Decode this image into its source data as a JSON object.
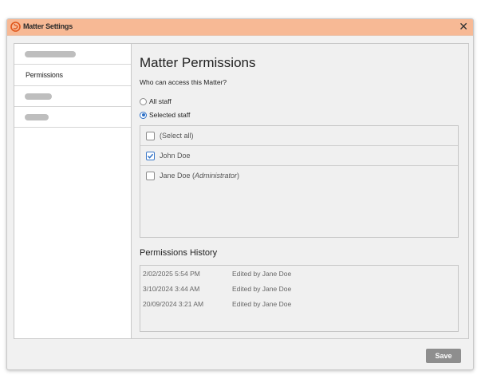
{
  "window": {
    "title": "Matter Settings",
    "close_glyph": "✕",
    "logo_icon": "app-logo-icon",
    "accent_color": "#f7b995"
  },
  "nav": {
    "active_item_label": "Permissions"
  },
  "main": {
    "heading": "Matter Permissions",
    "access_question": "Who can access this Matter?",
    "access_options": [
      {
        "label": "All staff",
        "selected": false
      },
      {
        "label": "Selected staff",
        "selected": true
      }
    ],
    "staff_list": [
      {
        "name": "(Select all)",
        "role": "",
        "checked": false
      },
      {
        "name": "John Doe",
        "role": "",
        "checked": true
      },
      {
        "name": "Jane Doe",
        "role": "Administrator",
        "checked": false
      }
    ],
    "history_title": "Permissions History",
    "history": [
      {
        "date": "2/02/2025 5:54 PM",
        "action": "Edited by Jane Doe"
      },
      {
        "date": "3/10/2024 3:44 AM",
        "action": "Edited by Jane Doe"
      },
      {
        "date": "20/09/2024 3:21 AM",
        "action": "Edited by Jane Doe"
      }
    ]
  },
  "footer": {
    "save_label": "Save"
  }
}
